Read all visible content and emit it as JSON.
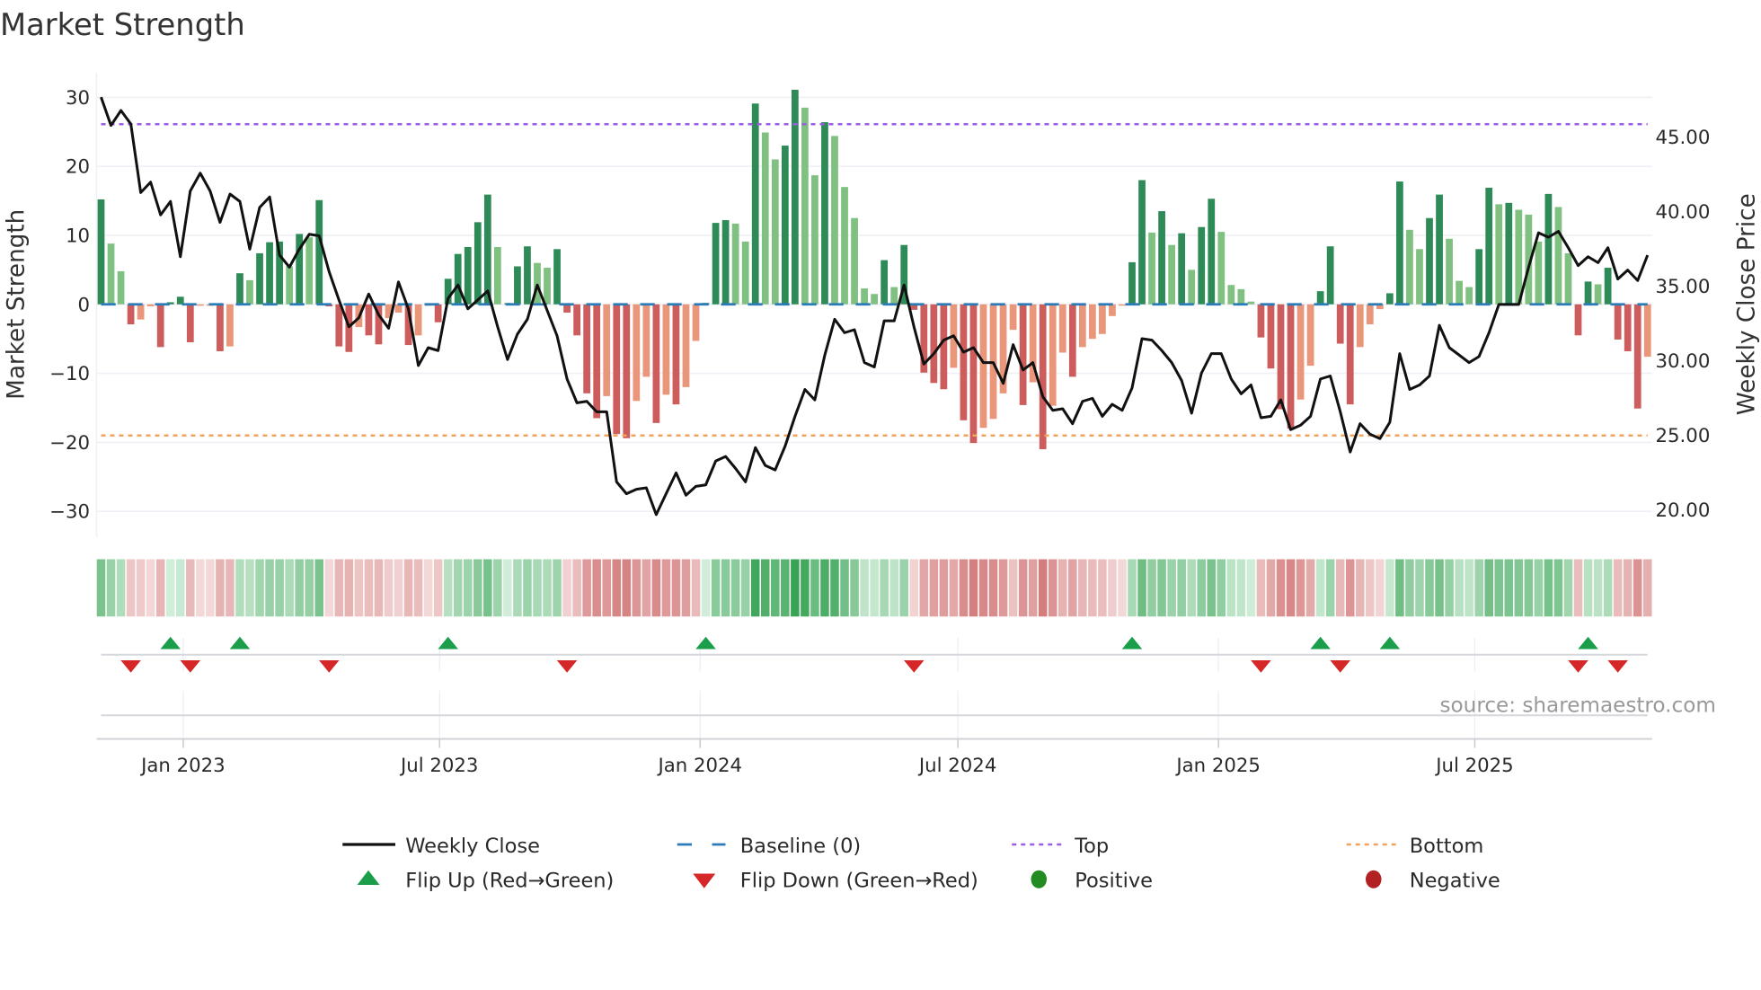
{
  "chart_data": {
    "type": "bar",
    "title": "Market Strength",
    "ylabel": "Market Strength",
    "y2label": "Weekly Close Price",
    "ylim": [
      -33,
      33
    ],
    "y2lim": [
      18.0,
      49.0
    ],
    "yticks": [
      30,
      20,
      10,
      0,
      -10,
      -20,
      -30
    ],
    "ytick_labels": [
      "30",
      "20",
      "10",
      "0",
      "−10",
      "−20",
      "−30"
    ],
    "y2ticks": [
      45,
      40,
      35,
      30,
      25,
      20
    ],
    "y2tick_labels": [
      "45.00",
      "40.00",
      "35.00",
      "30.00",
      "25.00",
      "20.00"
    ],
    "x_start": "2022-11-04",
    "x_step_days": 7,
    "xticks": [
      {
        "date": "2023-01-01",
        "label": "Jan 2023"
      },
      {
        "date": "2023-07-01",
        "label": "Jul 2023"
      },
      {
        "date": "2024-01-01",
        "label": "Jan 2024"
      },
      {
        "date": "2024-07-01",
        "label": "Jul 2024"
      },
      {
        "date": "2025-01-01",
        "label": "Jan 2025"
      },
      {
        "date": "2025-07-01",
        "label": "Jul 2025"
      }
    ],
    "top_level": 26.1,
    "bottom_level": -19.0,
    "baseline": 0,
    "grid": true,
    "legend_placement": "bottom-center",
    "series": [
      {
        "name": "Market Strength",
        "type": "bar",
        "values": [
          15.2,
          8.8,
          4.8,
          -2.9,
          -2.2,
          -0.3,
          -6.2,
          0.3,
          1.1,
          -5.5,
          -0.2,
          -0.2,
          -6.8,
          -6.1,
          4.5,
          3.5,
          7.4,
          9.0,
          9.1,
          5.5,
          10.2,
          9.7,
          15.1,
          -0.3,
          -6.1,
          -6.9,
          -3.3,
          -4.5,
          -5.8,
          -2.0,
          -1.2,
          -5.9,
          -4.5,
          -0.2,
          -2.6,
          3.7,
          7.3,
          8.3,
          11.9,
          15.9,
          8.3,
          0.2,
          5.5,
          8.4,
          6.0,
          5.3,
          8.0,
          -1.2,
          -4.5,
          -12.9,
          -16.5,
          -13.3,
          -18.8,
          -19.4,
          -14.0,
          -10.5,
          -17.2,
          -13.1,
          -14.5,
          -12.0,
          -5.3,
          0.2,
          11.8,
          12.2,
          11.7,
          9.1,
          29.1,
          24.9,
          21.0,
          23.0,
          31.1,
          28.5,
          18.7,
          26.4,
          24.4,
          17.0,
          12.5,
          2.3,
          1.5,
          6.4,
          2.5,
          8.6,
          -0.8,
          -9.9,
          -11.4,
          -12.3,
          -9.2,
          -16.8,
          -20.1,
          -17.9,
          -16.6,
          -12.9,
          -3.7,
          -14.6,
          -11.3,
          -21.0,
          -14.7,
          -7.0,
          -10.5,
          -6.2,
          -5.0,
          -4.3,
          -1.7,
          -0.2,
          6.1,
          18.0,
          10.4,
          13.5,
          8.6,
          10.3,
          5.0,
          11.2,
          15.3,
          10.5,
          2.8,
          2.2,
          0.4,
          -4.8,
          -9.3,
          -15.2,
          -18.0,
          -13.8,
          -8.9,
          1.9,
          8.4,
          -5.7,
          -14.5,
          -6.2,
          -2.9,
          -0.7,
          1.6,
          17.8,
          10.8,
          8.0,
          12.5,
          15.9,
          9.5,
          3.4,
          2.5,
          8.0,
          16.9,
          14.5,
          14.7,
          13.7,
          13.0,
          9.1,
          16.0,
          14.1,
          7.4,
          -4.5,
          3.3,
          2.9,
          5.3,
          -5.1,
          -6.8,
          -15.1,
          -7.6
        ]
      },
      {
        "name": "Weekly Close",
        "type": "line",
        "axis": "right",
        "values": [
          47.6,
          45.7,
          46.7,
          45.8,
          41.2,
          41.9,
          39.7,
          40.6,
          36.9,
          41.3,
          42.5,
          41.3,
          39.2,
          41.1,
          40.6,
          37.4,
          40.2,
          40.9,
          37.0,
          36.2,
          37.4,
          38.4,
          38.3,
          35.9,
          34.0,
          32.2,
          32.8,
          34.4,
          33.0,
          32.1,
          35.2,
          33.4,
          29.6,
          30.8,
          30.6,
          34.1,
          35.0,
          33.4,
          34.0,
          34.6,
          32.2,
          30.0,
          31.7,
          32.7,
          35.0,
          33.3,
          31.6,
          28.7,
          27.1,
          27.2,
          26.5,
          26.5,
          21.8,
          21.0,
          21.3,
          21.4,
          19.6,
          21.0,
          22.4,
          20.9,
          21.5,
          21.6,
          23.2,
          23.5,
          22.7,
          21.8,
          24.1,
          22.9,
          22.6,
          24.2,
          26.2,
          28.0,
          27.3,
          30.3,
          32.7,
          31.8,
          32.0,
          29.8,
          29.5,
          32.6,
          32.6,
          35.0,
          32.2,
          29.7,
          30.4,
          31.3,
          31.6,
          30.5,
          30.8,
          29.8,
          29.8,
          28.4,
          31.0,
          29.3,
          29.8,
          27.5,
          26.6,
          26.7,
          25.7,
          27.2,
          27.4,
          26.2,
          27.0,
          26.6,
          28.1,
          31.4,
          31.3,
          30.6,
          29.8,
          28.6,
          26.4,
          29.1,
          30.4,
          30.4,
          28.7,
          27.7,
          28.3,
          26.1,
          26.2,
          27.3,
          25.3,
          25.6,
          26.2,
          28.7,
          28.9,
          26.5,
          23.8,
          25.7,
          25.0,
          24.7,
          25.8,
          30.4,
          28.0,
          28.3,
          28.9,
          32.3,
          30.8,
          30.3,
          29.8,
          30.2,
          31.8,
          33.7,
          33.7,
          33.7,
          36.2,
          38.5,
          38.2,
          38.6,
          37.5,
          36.3,
          36.9,
          36.5,
          37.5,
          35.4,
          36.0,
          35.3,
          37.0
        ]
      }
    ],
    "legend": [
      {
        "key": "close",
        "label": "Weekly Close"
      },
      {
        "key": "baseline",
        "label": "Baseline (0)"
      },
      {
        "key": "top",
        "label": "Top"
      },
      {
        "key": "bottom",
        "label": "Bottom"
      },
      {
        "key": "flip_up",
        "label": "Flip Up (Red→Green)"
      },
      {
        "key": "flip_down",
        "label": "Flip Down (Green→Red)"
      },
      {
        "key": "positive",
        "label": "Positive"
      },
      {
        "key": "negative",
        "label": "Negative"
      }
    ]
  },
  "source": "source: sharemaestro.com",
  "colors": {
    "green_dark": "#2e8b57",
    "green_light": "#80c080",
    "red_dark": "#cd5c5c",
    "red_light": "#e9967a",
    "close": "#111111",
    "baseline": "#2b7bb9",
    "top": "#9b5de5",
    "bottom": "#f0a35e",
    "flip_up": "#1a9e4a",
    "flip_down": "#d62728",
    "positive": "#228b22",
    "negative": "#b22222"
  }
}
